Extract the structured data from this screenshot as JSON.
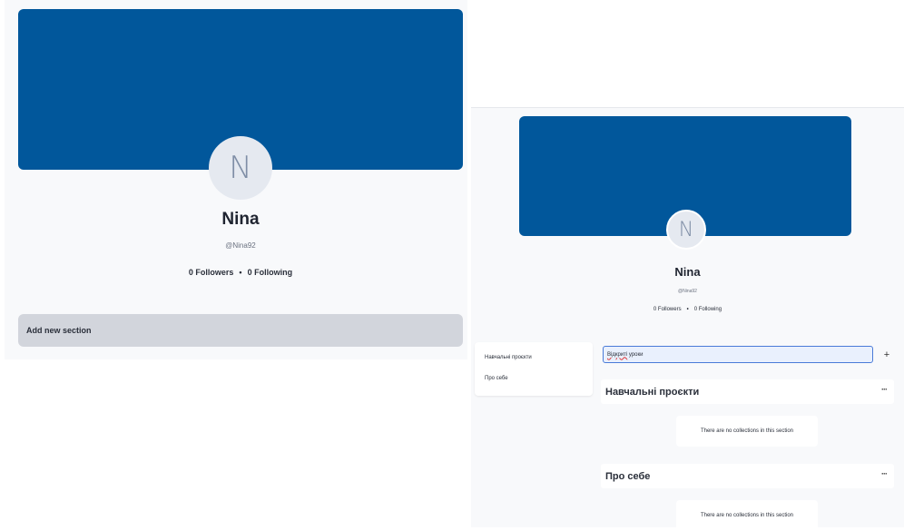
{
  "left": {
    "avatar_initial": "N",
    "name": "Nina",
    "handle": "@Nina92",
    "followers": "0 Followers",
    "separator": "•",
    "following": "0 Following",
    "add_section_label": "Add new section",
    "banner_color": "#01579b"
  },
  "right": {
    "avatar_initial": "N",
    "name": "Nina",
    "handle": "@Nina92",
    "followers": "0 Followers",
    "separator": "•",
    "following": "0 Following",
    "sidebar": {
      "items": [
        {
          "label": "Навчальні проєкти"
        },
        {
          "label": "Про себе"
        }
      ]
    },
    "new_section_input": {
      "value_word1": "Відкриті",
      "value_word2": " уроки"
    },
    "add_button": "+",
    "sections": [
      {
        "title": "Навчальні проєкти",
        "more": "···",
        "empty_text": "There are no collections in this section"
      },
      {
        "title": "Про себе",
        "more": "···",
        "empty_text": "There are no collections in this section"
      }
    ]
  }
}
